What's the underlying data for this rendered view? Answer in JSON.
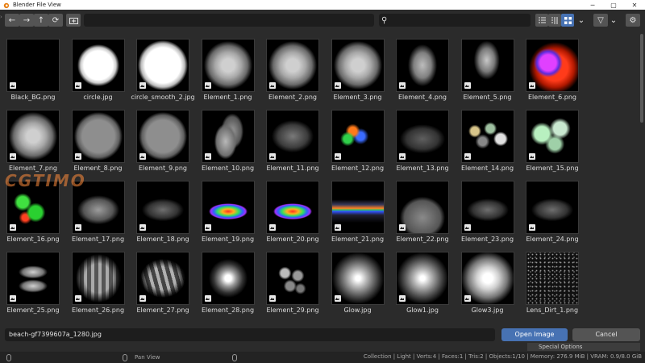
{
  "window": {
    "title": "Blender File View"
  },
  "toolbar": {
    "back_glyph": "←",
    "forward_glyph": "→",
    "parent_glyph": "↑",
    "refresh_glyph": "⟳",
    "search_glyph": "⚲",
    "filter_glyph": "▽",
    "gear_glyph": "⚙",
    "dropdown_glyph": "⌄"
  },
  "path": {
    "value": ""
  },
  "search": {
    "value": ""
  },
  "files": [
    {
      "name": "Black_BG.png",
      "style": "black"
    },
    {
      "name": "circle.jpg",
      "style": "circle"
    },
    {
      "name": "circle_smooth_2.jpg",
      "style": "circle2"
    },
    {
      "name": "Element_1.png",
      "style": "blob"
    },
    {
      "name": "Element_2.png",
      "style": "blob"
    },
    {
      "name": "Element_3.png",
      "style": "blob"
    },
    {
      "name": "Element_4.png",
      "style": "blob2"
    },
    {
      "name": "Element_5.png",
      "style": "blob3"
    },
    {
      "name": "Element_6.png",
      "style": "color6"
    },
    {
      "name": "Element_7.png",
      "style": "blob"
    },
    {
      "name": "Element_8.png",
      "style": "disc"
    },
    {
      "name": "Element_9.png",
      "style": "disc"
    },
    {
      "name": "Element_10.png",
      "style": "ovals"
    },
    {
      "name": "Element_11.png",
      "style": "blur"
    },
    {
      "name": "Element_12.png",
      "style": "color12"
    },
    {
      "name": "Element_13.png",
      "style": "ellipse"
    },
    {
      "name": "Element_14.png",
      "style": "bokeh"
    },
    {
      "name": "Element_15.png",
      "style": "bokeh2"
    },
    {
      "name": "Element_16.png",
      "style": "green"
    },
    {
      "name": "Element_17.png",
      "style": "dome"
    },
    {
      "name": "Element_18.png",
      "style": "dome2"
    },
    {
      "name": "Element_19.png",
      "style": "rainbow"
    },
    {
      "name": "Element_20.png",
      "style": "rainbow"
    },
    {
      "name": "Element_21.png",
      "style": "rainbow2"
    },
    {
      "name": "Element_22.png",
      "style": "dome3"
    },
    {
      "name": "Element_23.png",
      "style": "dome2"
    },
    {
      "name": "Element_24.png",
      "style": "dome2"
    },
    {
      "name": "Element_25.png",
      "style": "pills"
    },
    {
      "name": "Element_26.png",
      "style": "stripes"
    },
    {
      "name": "Element_27.png",
      "style": "stripes2"
    },
    {
      "name": "Element_28.png",
      "style": "dot"
    },
    {
      "name": "Element_29.png",
      "style": "dots"
    },
    {
      "name": "Glow.jpg",
      "style": "glow"
    },
    {
      "name": "Glow1.jpg",
      "style": "glow"
    },
    {
      "name": "Glow3.jpg",
      "style": "glow3"
    },
    {
      "name": "Lens_Dirt_1.png",
      "style": "dirt"
    }
  ],
  "bottom": {
    "filename": "beach-gf7399607a_1280.jpg",
    "open_label": "Open Image",
    "cancel_label": "Cancel",
    "special_label": "Special Options"
  },
  "status": {
    "pan_label": "Pan View",
    "stats": "Collection | Light | Verts:4 | Faces:1 | Tris:2 | Objects:1/10 | Memory: 276.9 MiB | VRAM: 0.9/8.0 GiB"
  },
  "watermark": "CGTIMO"
}
